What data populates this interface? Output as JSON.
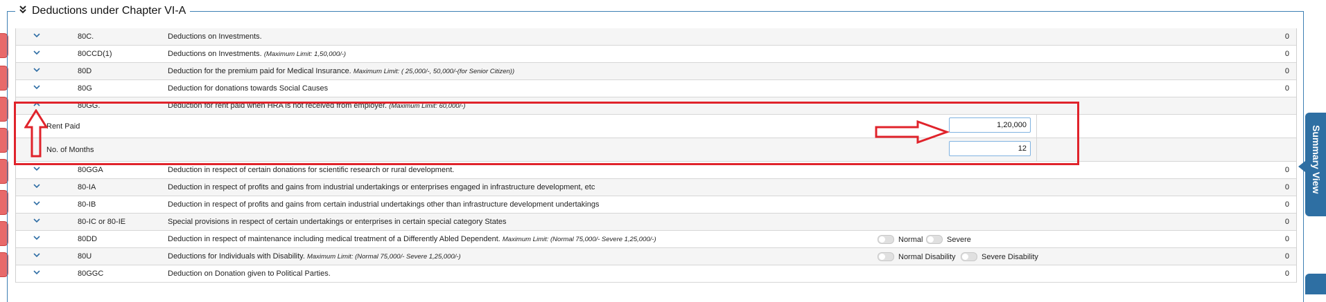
{
  "section": {
    "title": "Deductions under Chapter VI-A"
  },
  "rows": [
    {
      "code": "80C.",
      "desc": "Deductions on Investments.",
      "note": "",
      "value": "0"
    },
    {
      "code": "80CCD(1)",
      "desc": "Deductions on Investments.",
      "note": "(Maximum Limit: 1,50,000/-)",
      "value": "0"
    },
    {
      "code": "80D",
      "desc": "Deduction for the premium paid for Medical Insurance.",
      "note": "Maximum Limit: ( 25,000/-, 50,000/-(for Senior Citizen))",
      "value": "0"
    },
    {
      "code": "80G",
      "desc": "Deduction for donations towards Social Causes",
      "note": "",
      "value": "0"
    },
    {
      "code": "80GG.",
      "desc": "Deduction for rent paid when HRA is not received from employer.",
      "note": "(Maximum Limit: 60,000/-)",
      "value": ""
    },
    {
      "code": "80GGA",
      "desc": "Deduction in respect of certain donations for scientific research or rural development.",
      "note": "",
      "value": "0"
    },
    {
      "code": "80-IA",
      "desc": "Deduction in respect of profits and gains from industrial undertakings or enterprises engaged in infrastructure development, etc",
      "note": "",
      "value": "0"
    },
    {
      "code": "80-IB",
      "desc": "Deduction in respect of profits and gains from certain industrial undertakings other than infrastructure development undertakings",
      "note": "",
      "value": "0"
    },
    {
      "code": "80-IC or 80-IE",
      "desc": "Special provisions in respect of certain undertakings or enterprises in certain special category States",
      "note": "",
      "value": "0"
    },
    {
      "code": "80DD",
      "desc": "Deduction in respect of maintenance including medical treatment of a Differently Abled Dependent.",
      "note": "Maximum Limit: (Normal 75,000/- Severe 1,25,000/-)",
      "value": "0"
    },
    {
      "code": "80U",
      "desc": "Deductions for Individuals with Disability.",
      "note": "Maximum Limit: (Normal 75,000/- Severe 1,25,000/-)",
      "value": "0"
    },
    {
      "code": "80GGC",
      "desc": "Deduction on Donation given to Political Parties.",
      "note": "",
      "value": "0"
    }
  ],
  "rent_paid": {
    "label": "Rent Paid",
    "value": "1,20,000"
  },
  "months": {
    "label": "No. of Months",
    "value": "12"
  },
  "dd_switches": {
    "normal": "Normal",
    "severe": "Severe"
  },
  "u_switches": {
    "normal": "Normal Disability",
    "severe": "Severe Disability"
  },
  "summary_tab": {
    "label": "Summary View"
  },
  "colors": {
    "accent": "#2e6fa3",
    "highlight": "#e0232b"
  }
}
